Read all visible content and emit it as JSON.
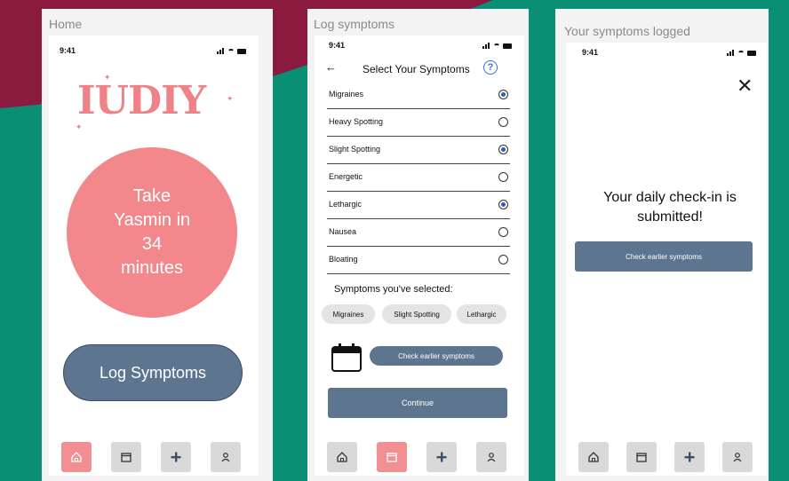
{
  "colors": {
    "background": "#0a8f74",
    "maroon": "#8b1a3f",
    "accent_pink": "#f2888b",
    "slate_button": "#5e7590",
    "radio_selected": "#2d5fb8"
  },
  "screen_home": {
    "frame_label": "Home",
    "time": "9:41",
    "logo": "IUDIY",
    "reminder_text": "Take\nYasmin in\n34\nminutes",
    "log_button": "Log Symptoms",
    "nav": [
      {
        "icon": "home-icon",
        "active": true
      },
      {
        "icon": "calendar-icon",
        "active": false
      },
      {
        "icon": "plus-icon",
        "active": false
      },
      {
        "icon": "profile-icon",
        "active": false
      }
    ]
  },
  "screen_log": {
    "frame_label": "Log symptoms",
    "time": "9:41",
    "title": "Select Your Symptoms",
    "back_icon": "back-arrow-icon",
    "help_icon": "help-icon",
    "symptoms": [
      {
        "label": "Migraines",
        "selected": true
      },
      {
        "label": "Heavy Spotting",
        "selected": false
      },
      {
        "label": "Slight Spotting",
        "selected": true
      },
      {
        "label": "Energetic",
        "selected": false
      },
      {
        "label": "Lethargic",
        "selected": true
      },
      {
        "label": "Nausea",
        "selected": false
      },
      {
        "label": "Bloating",
        "selected": false
      }
    ],
    "selected_title": "Symptoms you've selected:",
    "chips": [
      "Migraines",
      "Slight Spotting",
      "Lethargic"
    ],
    "check_earlier": "Check earlier symptoms",
    "continue": "Continue",
    "nav": [
      {
        "icon": "home-icon",
        "active": false
      },
      {
        "icon": "calendar-icon",
        "active": true
      },
      {
        "icon": "plus-icon",
        "active": false
      },
      {
        "icon": "profile-icon",
        "active": false
      }
    ]
  },
  "screen_done": {
    "frame_label": "Your symptoms logged",
    "time": "9:41",
    "close_icon": "close-icon",
    "message": "Your daily check-in is submitted!",
    "check_earlier": "Check earlier symptoms",
    "nav": [
      {
        "icon": "home-icon",
        "active": false
      },
      {
        "icon": "calendar-icon",
        "active": false
      },
      {
        "icon": "plus-icon",
        "active": false
      },
      {
        "icon": "profile-icon",
        "active": false
      }
    ]
  }
}
